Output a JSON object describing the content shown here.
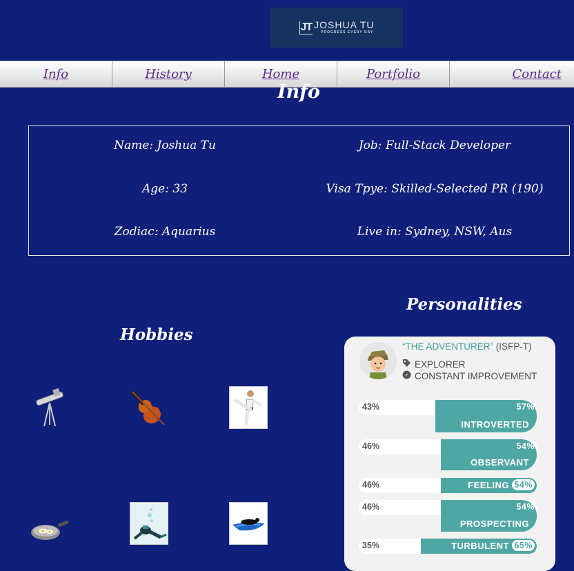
{
  "logo": {
    "mark": "JT",
    "name": "JOSHUA  TU",
    "tagline": "PROGRESS EVERY DAY"
  },
  "nav": [
    {
      "label": "Info"
    },
    {
      "label": "History"
    },
    {
      "label": "Home"
    },
    {
      "label": "Portfolio"
    },
    {
      "label": "Contact"
    }
  ],
  "info": {
    "title": "Info",
    "name": "Name: Joshua Tu",
    "job": "Job: Full-Stack Developer",
    "age": "Age: 33",
    "visa": "Visa Tpye: Skilled-Selected PR (190)",
    "zodiac": "Zodiac: Aquarius",
    "live": "Live in: Sydney, NSW, Aus"
  },
  "hobbies": {
    "title": "Hobbies",
    "items": [
      {
        "icon": "telescope-icon"
      },
      {
        "icon": "violin-icon"
      },
      {
        "icon": "martial-arts-icon"
      },
      {
        "icon": "frying-pan-icon"
      },
      {
        "icon": "scuba-diving-icon"
      },
      {
        "icon": "surfing-icon"
      }
    ]
  },
  "personalities": {
    "title": "Personalities",
    "type_name": "“THE ADVENTURER”",
    "type_code": "(ISFP-T)",
    "role": "EXPLORER",
    "strategy": "CONSTANT IMPROVEMENT",
    "accent": "#4fa7a4",
    "traits": [
      {
        "left_pct": "43%",
        "right_pct": "57%",
        "label": "INTROVERTED",
        "value": 57
      },
      {
        "left_pct": "46%",
        "right_pct": "54%",
        "label": "OBSERVANT",
        "value": 54
      },
      {
        "left_pct": "46%",
        "right_pct": "54%",
        "label": "FEELING",
        "value": 54
      },
      {
        "left_pct": "46%",
        "right_pct": "54%",
        "label": "PROSPECTING",
        "value": 54
      },
      {
        "left_pct": "35%",
        "right_pct": "65%",
        "label": "TURBULENT",
        "value": 65
      }
    ]
  },
  "colors": {
    "background": "#0f1f7a",
    "nav_link": "#5a2d8c",
    "logo_bg": "#16335f"
  }
}
